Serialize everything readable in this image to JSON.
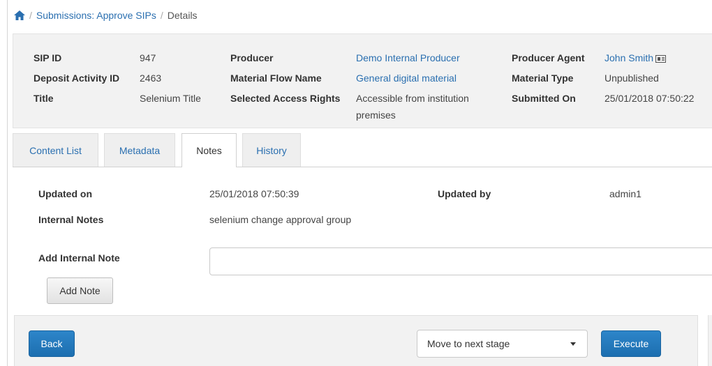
{
  "breadcrumb": {
    "home_icon": "home-icon",
    "items": [
      "Submissions: Approve SIPs",
      "Details"
    ]
  },
  "info": {
    "col1": [
      {
        "label": "SIP ID",
        "value": "947"
      },
      {
        "label": "Deposit Activity ID",
        "value": "2463"
      },
      {
        "label": "Title",
        "value": "Selenium Title"
      }
    ],
    "col2": [
      {
        "label": "Producer",
        "value": "Demo Internal Producer"
      },
      {
        "label": "Material Flow Name",
        "value": "General digital material"
      },
      {
        "label": "Selected Access Rights",
        "value_line1": "Accessible from institution",
        "value_line2": "premises"
      }
    ],
    "col3": [
      {
        "label": "Producer Agent",
        "value": "John Smith",
        "icon": "contact-card-icon"
      },
      {
        "label": "Material Type",
        "value": "Unpublished"
      },
      {
        "label": "Submitted On",
        "value": "25/01/2018 07:50:22"
      }
    ]
  },
  "tabs": [
    {
      "label": "Content List"
    },
    {
      "label": "Metadata"
    },
    {
      "label": "Notes",
      "active": true
    },
    {
      "label": "History"
    }
  ],
  "notes": {
    "updated_on_label": "Updated on",
    "updated_on_value": "25/01/2018 07:50:39",
    "updated_by_label": "Updated by",
    "updated_by_value": "admin1",
    "internal_notes_label": "Internal Notes",
    "internal_notes_value": "selenium change approval group",
    "add_note_label": "Add Internal Note",
    "add_note_value": "",
    "add_note_button": "Add Note"
  },
  "footer": {
    "back_button": "Back",
    "stage_select": "Move to next stage",
    "execute_button": "Execute"
  },
  "colors": {
    "link": "#2a6fb0",
    "primary_button": "#1d6fb0",
    "panel_bg": "#f2f2f2"
  }
}
